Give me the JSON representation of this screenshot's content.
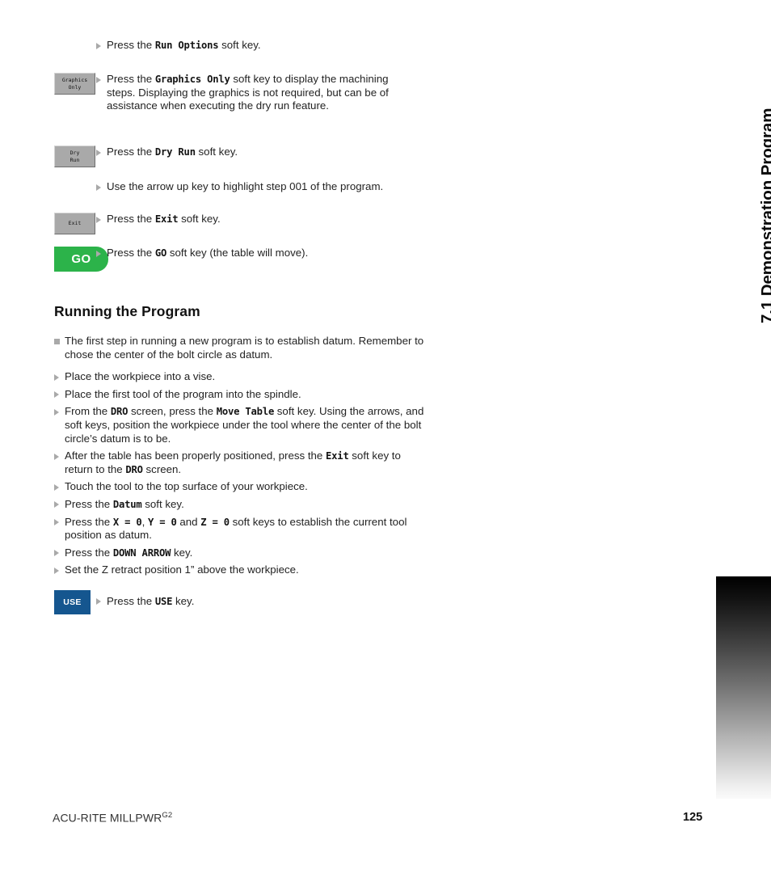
{
  "running_head": "7.1 Demonstration Program",
  "footer": {
    "brand": "ACU-RITE MILLPWR",
    "brand_sup": "G2",
    "page_number": "125"
  },
  "colors": {
    "softkey_gray": "#a9a9a9",
    "go_green": "#2cb34a",
    "use_blue": "#15568f",
    "bullet_gray": "#a9a9a9",
    "text": "#232323"
  },
  "keys": {
    "graphics_only": {
      "line1": "Graphics",
      "line2": "Only"
    },
    "dry_run": {
      "line1": "Dry",
      "line2": "Run"
    },
    "exit": {
      "line1": "Exit",
      "line2": ""
    },
    "go": "GO",
    "use": "USE"
  },
  "top_steps": [
    {
      "id": "run-options",
      "key": null,
      "parts": [
        {
          "t": "Press the ",
          "m": false
        },
        {
          "t": "Run Options",
          "m": true
        },
        {
          "t": " soft key.",
          "m": false
        }
      ]
    },
    {
      "id": "graphics-only",
      "key": "graphics_only",
      "parts": [
        {
          "t": "Press the ",
          "m": false
        },
        {
          "t": "Graphics Only",
          "m": true
        },
        {
          "t": " soft key to display the machining steps. Displaying the graphics is not required, but can be of assistance when executing the dry run feature.",
          "m": false
        }
      ]
    },
    {
      "id": "dry-run",
      "key": "dry_run",
      "parts": [
        {
          "t": "Press the ",
          "m": false
        },
        {
          "t": "Dry Run",
          "m": true
        },
        {
          "t": " soft key.",
          "m": false
        }
      ]
    },
    {
      "id": "arrow-up",
      "key": null,
      "parts": [
        {
          "t": "Use the arrow up key to highlight step 001 of the program.",
          "m": false
        }
      ]
    },
    {
      "id": "exit",
      "key": "exit",
      "parts": [
        {
          "t": "Press the ",
          "m": false
        },
        {
          "t": "Exit",
          "m": true
        },
        {
          "t": " soft key.",
          "m": false
        }
      ]
    },
    {
      "id": "go",
      "key": "go",
      "parts": [
        {
          "t": "Press the ",
          "m": false
        },
        {
          "t": "GO",
          "m": true
        },
        {
          "t": " soft key (the table will move).",
          "m": false
        }
      ]
    }
  ],
  "section": {
    "heading": "Running the Program",
    "items": [
      {
        "id": "establish-datum",
        "bullet": "square",
        "parts": [
          {
            "t": "The first step in running a new program is to establish datum. Remember to chose the center of the bolt circle as datum.",
            "m": false
          }
        ]
      },
      {
        "id": "workpiece-vise",
        "bullet": "triangle",
        "parts": [
          {
            "t": "Place the workpiece into a vise.",
            "m": false
          }
        ]
      },
      {
        "id": "first-tool-spindle",
        "bullet": "triangle",
        "parts": [
          {
            "t": "Place the first tool of the program into the spindle.",
            "m": false
          }
        ]
      },
      {
        "id": "move-table",
        "bullet": "triangle",
        "parts": [
          {
            "t": "From the ",
            "m": false
          },
          {
            "t": "DRO",
            "m": true
          },
          {
            "t": " screen, press the ",
            "m": false
          },
          {
            "t": "Move Table",
            "m": true
          },
          {
            "t": " soft key. Using the arrows, and soft keys, position the workpiece under the tool where the center of the bolt circle’s datum is to be.",
            "m": false
          }
        ]
      },
      {
        "id": "exit-to-dro",
        "bullet": "triangle",
        "parts": [
          {
            "t": "After the table has been properly positioned, press the ",
            "m": false
          },
          {
            "t": "Exit",
            "m": true
          },
          {
            "t": " soft key to return to the ",
            "m": false
          },
          {
            "t": "DRO",
            "m": true
          },
          {
            "t": " screen.",
            "m": false
          }
        ]
      },
      {
        "id": "touch-tool",
        "bullet": "triangle",
        "parts": [
          {
            "t": "Touch the tool to the top surface of your workpiece.",
            "m": false
          }
        ]
      },
      {
        "id": "press-datum",
        "bullet": "triangle",
        "parts": [
          {
            "t": "Press the ",
            "m": false
          },
          {
            "t": "Datum",
            "m": true
          },
          {
            "t": " soft key.",
            "m": false
          }
        ]
      },
      {
        "id": "zero-axes",
        "bullet": "triangle",
        "parts": [
          {
            "t": "Press the ",
            "m": false
          },
          {
            "t": "X = 0",
            "m": true
          },
          {
            "t": ", ",
            "m": false
          },
          {
            "t": "Y = 0",
            "m": true
          },
          {
            "t": " and ",
            "m": false
          },
          {
            "t": "Z = 0",
            "m": true
          },
          {
            "t": " soft keys to establish the current tool position as datum.",
            "m": false
          }
        ]
      },
      {
        "id": "down-arrow",
        "bullet": "triangle",
        "parts": [
          {
            "t": "Press the ",
            "m": false
          },
          {
            "t": "DOWN ARROW",
            "m": true
          },
          {
            "t": " key.",
            "m": false
          }
        ]
      },
      {
        "id": "z-retract",
        "bullet": "triangle",
        "parts": [
          {
            "t": "Set the Z retract position 1” above the workpiece.",
            "m": false
          }
        ]
      }
    ],
    "use_step": {
      "id": "press-use",
      "parts": [
        {
          "t": "Press the ",
          "m": false
        },
        {
          "t": "USE",
          "m": true
        },
        {
          "t": " key.",
          "m": false
        }
      ]
    }
  }
}
